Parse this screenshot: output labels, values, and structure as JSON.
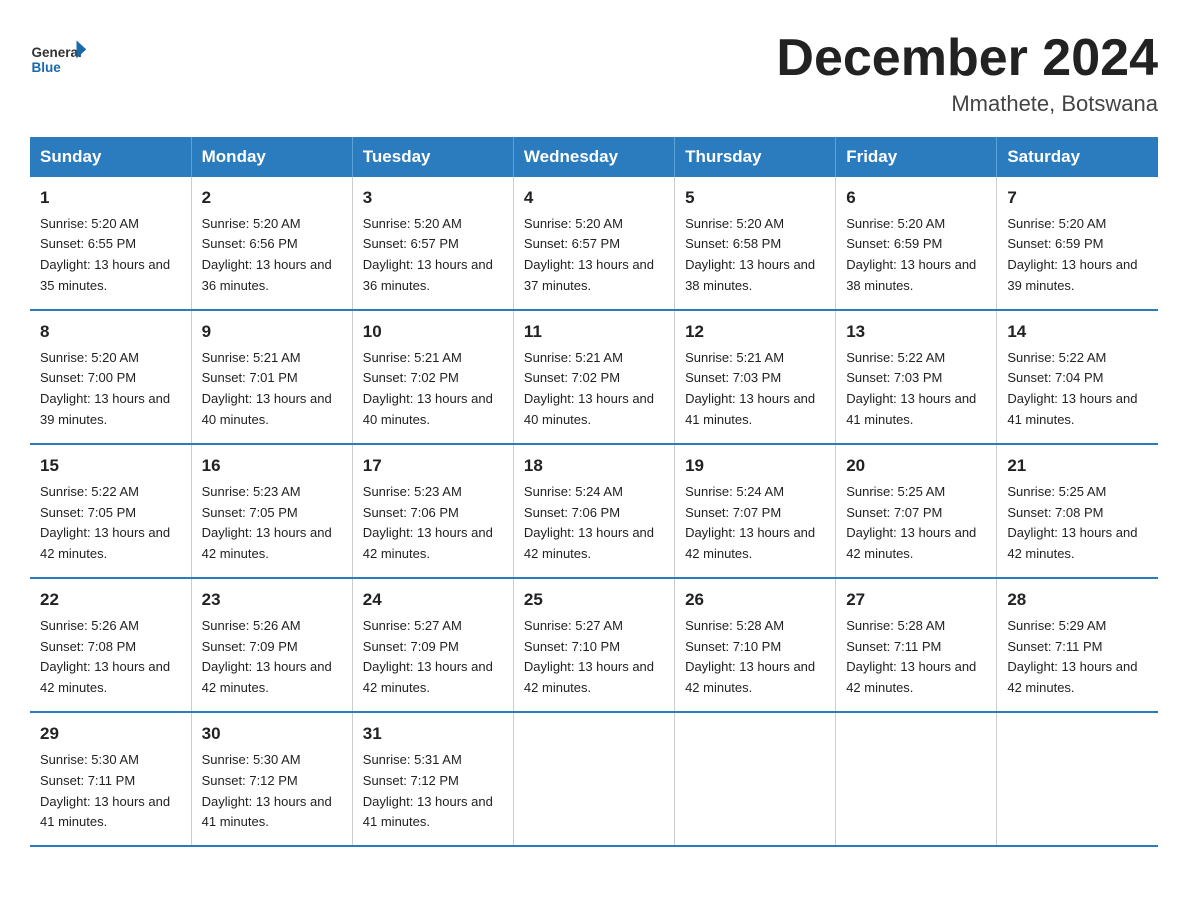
{
  "header": {
    "logo_general": "General",
    "logo_blue": "Blue",
    "month_title": "December 2024",
    "location": "Mmathete, Botswana"
  },
  "calendar": {
    "headers": [
      "Sunday",
      "Monday",
      "Tuesday",
      "Wednesday",
      "Thursday",
      "Friday",
      "Saturday"
    ],
    "weeks": [
      [
        {
          "day": "1",
          "sunrise": "5:20 AM",
          "sunset": "6:55 PM",
          "daylight": "13 hours and 35 minutes."
        },
        {
          "day": "2",
          "sunrise": "5:20 AM",
          "sunset": "6:56 PM",
          "daylight": "13 hours and 36 minutes."
        },
        {
          "day": "3",
          "sunrise": "5:20 AM",
          "sunset": "6:57 PM",
          "daylight": "13 hours and 36 minutes."
        },
        {
          "day": "4",
          "sunrise": "5:20 AM",
          "sunset": "6:57 PM",
          "daylight": "13 hours and 37 minutes."
        },
        {
          "day": "5",
          "sunrise": "5:20 AM",
          "sunset": "6:58 PM",
          "daylight": "13 hours and 38 minutes."
        },
        {
          "day": "6",
          "sunrise": "5:20 AM",
          "sunset": "6:59 PM",
          "daylight": "13 hours and 38 minutes."
        },
        {
          "day": "7",
          "sunrise": "5:20 AM",
          "sunset": "6:59 PM",
          "daylight": "13 hours and 39 minutes."
        }
      ],
      [
        {
          "day": "8",
          "sunrise": "5:20 AM",
          "sunset": "7:00 PM",
          "daylight": "13 hours and 39 minutes."
        },
        {
          "day": "9",
          "sunrise": "5:21 AM",
          "sunset": "7:01 PM",
          "daylight": "13 hours and 40 minutes."
        },
        {
          "day": "10",
          "sunrise": "5:21 AM",
          "sunset": "7:02 PM",
          "daylight": "13 hours and 40 minutes."
        },
        {
          "day": "11",
          "sunrise": "5:21 AM",
          "sunset": "7:02 PM",
          "daylight": "13 hours and 40 minutes."
        },
        {
          "day": "12",
          "sunrise": "5:21 AM",
          "sunset": "7:03 PM",
          "daylight": "13 hours and 41 minutes."
        },
        {
          "day": "13",
          "sunrise": "5:22 AM",
          "sunset": "7:03 PM",
          "daylight": "13 hours and 41 minutes."
        },
        {
          "day": "14",
          "sunrise": "5:22 AM",
          "sunset": "7:04 PM",
          "daylight": "13 hours and 41 minutes."
        }
      ],
      [
        {
          "day": "15",
          "sunrise": "5:22 AM",
          "sunset": "7:05 PM",
          "daylight": "13 hours and 42 minutes."
        },
        {
          "day": "16",
          "sunrise": "5:23 AM",
          "sunset": "7:05 PM",
          "daylight": "13 hours and 42 minutes."
        },
        {
          "day": "17",
          "sunrise": "5:23 AM",
          "sunset": "7:06 PM",
          "daylight": "13 hours and 42 minutes."
        },
        {
          "day": "18",
          "sunrise": "5:24 AM",
          "sunset": "7:06 PM",
          "daylight": "13 hours and 42 minutes."
        },
        {
          "day": "19",
          "sunrise": "5:24 AM",
          "sunset": "7:07 PM",
          "daylight": "13 hours and 42 minutes."
        },
        {
          "day": "20",
          "sunrise": "5:25 AM",
          "sunset": "7:07 PM",
          "daylight": "13 hours and 42 minutes."
        },
        {
          "day": "21",
          "sunrise": "5:25 AM",
          "sunset": "7:08 PM",
          "daylight": "13 hours and 42 minutes."
        }
      ],
      [
        {
          "day": "22",
          "sunrise": "5:26 AM",
          "sunset": "7:08 PM",
          "daylight": "13 hours and 42 minutes."
        },
        {
          "day": "23",
          "sunrise": "5:26 AM",
          "sunset": "7:09 PM",
          "daylight": "13 hours and 42 minutes."
        },
        {
          "day": "24",
          "sunrise": "5:27 AM",
          "sunset": "7:09 PM",
          "daylight": "13 hours and 42 minutes."
        },
        {
          "day": "25",
          "sunrise": "5:27 AM",
          "sunset": "7:10 PM",
          "daylight": "13 hours and 42 minutes."
        },
        {
          "day": "26",
          "sunrise": "5:28 AM",
          "sunset": "7:10 PM",
          "daylight": "13 hours and 42 minutes."
        },
        {
          "day": "27",
          "sunrise": "5:28 AM",
          "sunset": "7:11 PM",
          "daylight": "13 hours and 42 minutes."
        },
        {
          "day": "28",
          "sunrise": "5:29 AM",
          "sunset": "7:11 PM",
          "daylight": "13 hours and 42 minutes."
        }
      ],
      [
        {
          "day": "29",
          "sunrise": "5:30 AM",
          "sunset": "7:11 PM",
          "daylight": "13 hours and 41 minutes."
        },
        {
          "day": "30",
          "sunrise": "5:30 AM",
          "sunset": "7:12 PM",
          "daylight": "13 hours and 41 minutes."
        },
        {
          "day": "31",
          "sunrise": "5:31 AM",
          "sunset": "7:12 PM",
          "daylight": "13 hours and 41 minutes."
        },
        {
          "day": "",
          "sunrise": "",
          "sunset": "",
          "daylight": ""
        },
        {
          "day": "",
          "sunrise": "",
          "sunset": "",
          "daylight": ""
        },
        {
          "day": "",
          "sunrise": "",
          "sunset": "",
          "daylight": ""
        },
        {
          "day": "",
          "sunrise": "",
          "sunset": "",
          "daylight": ""
        }
      ]
    ]
  }
}
